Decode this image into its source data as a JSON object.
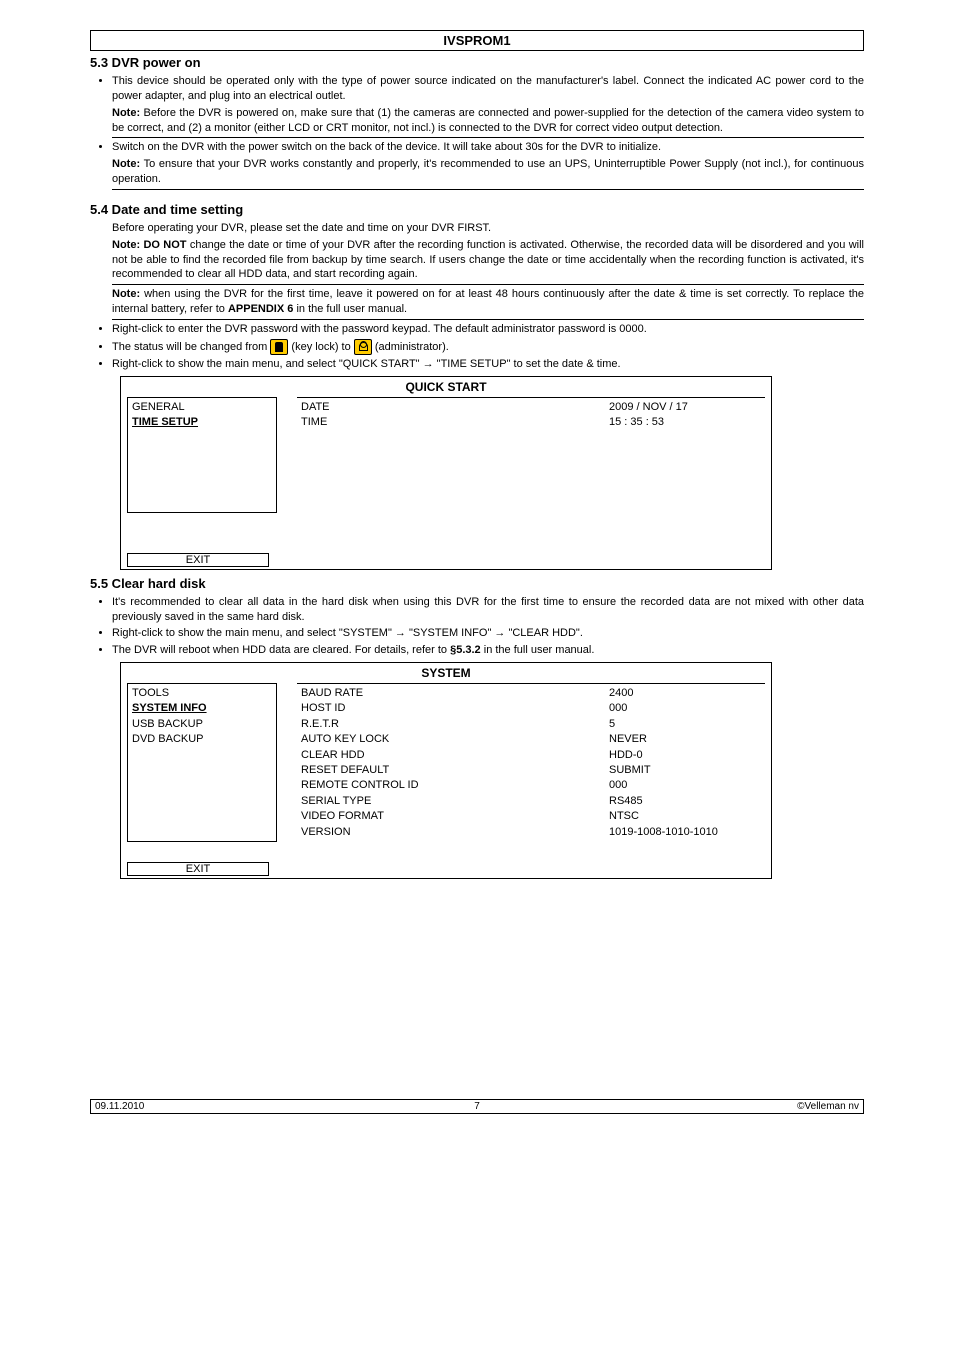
{
  "header": {
    "title": "IVSPROM1"
  },
  "section53": {
    "heading": "5.3 DVR power on",
    "bullet1": "This device should be operated only with the type of power source indicated on the manufacturer's label. Connect the indicated AC power cord to the power adapter, and plug into an electrical outlet.",
    "note1_label": "Note:",
    "note1": " Before the DVR is powered on, make sure that (1) the cameras are connected and power-supplied for the detection of the camera video system to be correct, and (2) a monitor (either LCD or CRT monitor, not incl.) is connected to the DVR for correct video output detection.",
    "bullet2": "Switch on the DVR with the power switch on the back of the device. It will take about 30s for the DVR to initialize.",
    "note2_label": "Note:",
    "note2": " To ensure that your DVR works constantly and properly, it's recommended to use an UPS, Uninterruptible Power Supply (not incl.), for continuous operation."
  },
  "section54": {
    "heading": "5.4 Date and time setting",
    "intro": "Before operating your DVR, please set the date and time on your DVR FIRST.",
    "note1_label": "Note: DO NOT",
    "note1": " change the date or time of your DVR after the recording function is activated. Otherwise, the recorded data will be disordered and you will not be able to find the recorded file from backup by time search. If users change the date or time accidentally when the recording function is activated, it's recommended to clear all HDD data, and start recording again.",
    "note2_label": "Note:",
    "note2_a": " when using the DVR for the first time, leave it powered on for at least 48 hours continuously after the date & time is set correctly. To replace the internal battery, refer to ",
    "note2_bold": "APPENDIX 6",
    "note2_b": " in the full user manual.",
    "bullet1": "Right-click to enter the DVR password with the password keypad. The default administrator password is 0000.",
    "bullet2_a": "The status will be changed from ",
    "bullet2_b": " (key lock) to ",
    "bullet2_c": " (administrator).",
    "bullet3": "Right-click to show the main menu, and select \"QUICK START\" → \"TIME SETUP\" to set the date & time."
  },
  "quickstart_menu": {
    "title": "QUICK START",
    "left": {
      "item1": "GENERAL",
      "item2": "TIME SETUP"
    },
    "labels": {
      "date": "DATE",
      "time": "TIME"
    },
    "values": {
      "date": "2009 / NOV / 17",
      "time": "15 : 35 : 53"
    },
    "exit": "EXIT"
  },
  "section55": {
    "heading": "5.5 Clear hard disk",
    "bullet1": "It's recommended to clear all data in the hard disk when using this DVR for the first time to ensure the recorded data are not mixed with other data previously saved in the same hard disk.",
    "bullet2": "Right-click to show the main menu, and select \"SYSTEM\" → \"SYSTEM INFO\" → \"CLEAR HDD\".",
    "bullet3_a": "The DVR will reboot when HDD data are cleared. For details, refer to ",
    "bullet3_bold": "§5.3.2",
    "bullet3_b": " in the full user manual."
  },
  "system_menu": {
    "title": "SYSTEM",
    "left": {
      "item1": "TOOLS",
      "item2": "SYSTEM INFO",
      "item3": "USB BACKUP",
      "item4": "DVD BACKUP"
    },
    "labels": {
      "r1": "BAUD RATE",
      "r2": "HOST ID",
      "r3": "R.E.T.R",
      "r4": "AUTO KEY LOCK",
      "r5": "CLEAR HDD",
      "r6": "RESET DEFAULT",
      "r7": "REMOTE CONTROL ID",
      "r8": "SERIAL TYPE",
      "r9": "VIDEO FORMAT",
      "r10": "VERSION"
    },
    "values": {
      "r1": "2400",
      "r2": "000",
      "r3": "5",
      "r4": "NEVER",
      "r5": "HDD-0",
      "r6": "SUBMIT",
      "r7": "000",
      "r8": "RS485",
      "r9": "NTSC",
      "r10": "1019-1008-1010-1010"
    },
    "exit": "EXIT"
  },
  "footer": {
    "date": "09.11.2010",
    "page": "7",
    "copyright": "©Velleman nv"
  }
}
